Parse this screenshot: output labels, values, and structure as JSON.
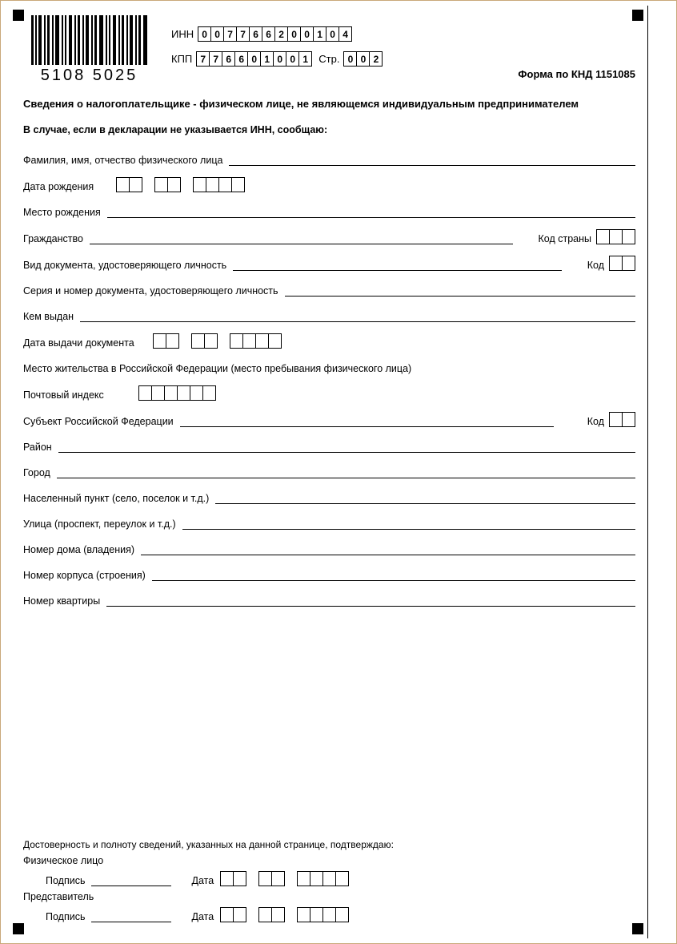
{
  "barcode_number": "5108 5025",
  "header": {
    "inn_label": "ИНН",
    "inn": [
      "0",
      "0",
      "7",
      "7",
      "6",
      "6",
      "2",
      "0",
      "0",
      "1",
      "0",
      "4"
    ],
    "kpp_label": "КПП",
    "kpp": [
      "7",
      "7",
      "6",
      "6",
      "0",
      "1",
      "0",
      "0",
      "1"
    ],
    "page_label": "Стр.",
    "page": [
      "0",
      "0",
      "2"
    ],
    "forma": "Форма по КНД 1151085"
  },
  "title": "Сведения о налогоплательщике - физическом лице, не являющемся индивидуальным предпринимателем",
  "subtitle": "В случае, если в декларации не указывается ИНН, сообщаю:",
  "labels": {
    "fio": "Фамилия, имя, отчество физического лица",
    "dob": "Дата рождения",
    "pob": "Место рождения",
    "citizenship": "Гражданство",
    "country_code": "Код страны",
    "doc_type": "Вид документа, удостоверяющего личность",
    "code": "Код",
    "doc_series": "Серия и номер документа, удостоверяющего личность",
    "issued_by": "Кем выдан",
    "issue_date": "Дата выдачи документа",
    "residence": "Место жительства в Российской Федерации (место пребывания физического лица)",
    "postal": "Почтовый индекс",
    "subject_rf": "Субъект Российской Федерации",
    "district": "Район",
    "city": "Город",
    "settlement": "Населенный пункт (село, поселок и т.д.)",
    "street": "Улица (проспект, переулок и т.д.)",
    "house": "Номер дома (владения)",
    "building": "Номер корпуса (строения)",
    "apartment": "Номер квартиры"
  },
  "footer": {
    "confirm": "Достоверность и полноту сведений, указанных на данной странице, подтверждаю:",
    "person": "Физическое лицо",
    "rep": "Представитель",
    "sign": "Подпись",
    "date": "Дата"
  }
}
